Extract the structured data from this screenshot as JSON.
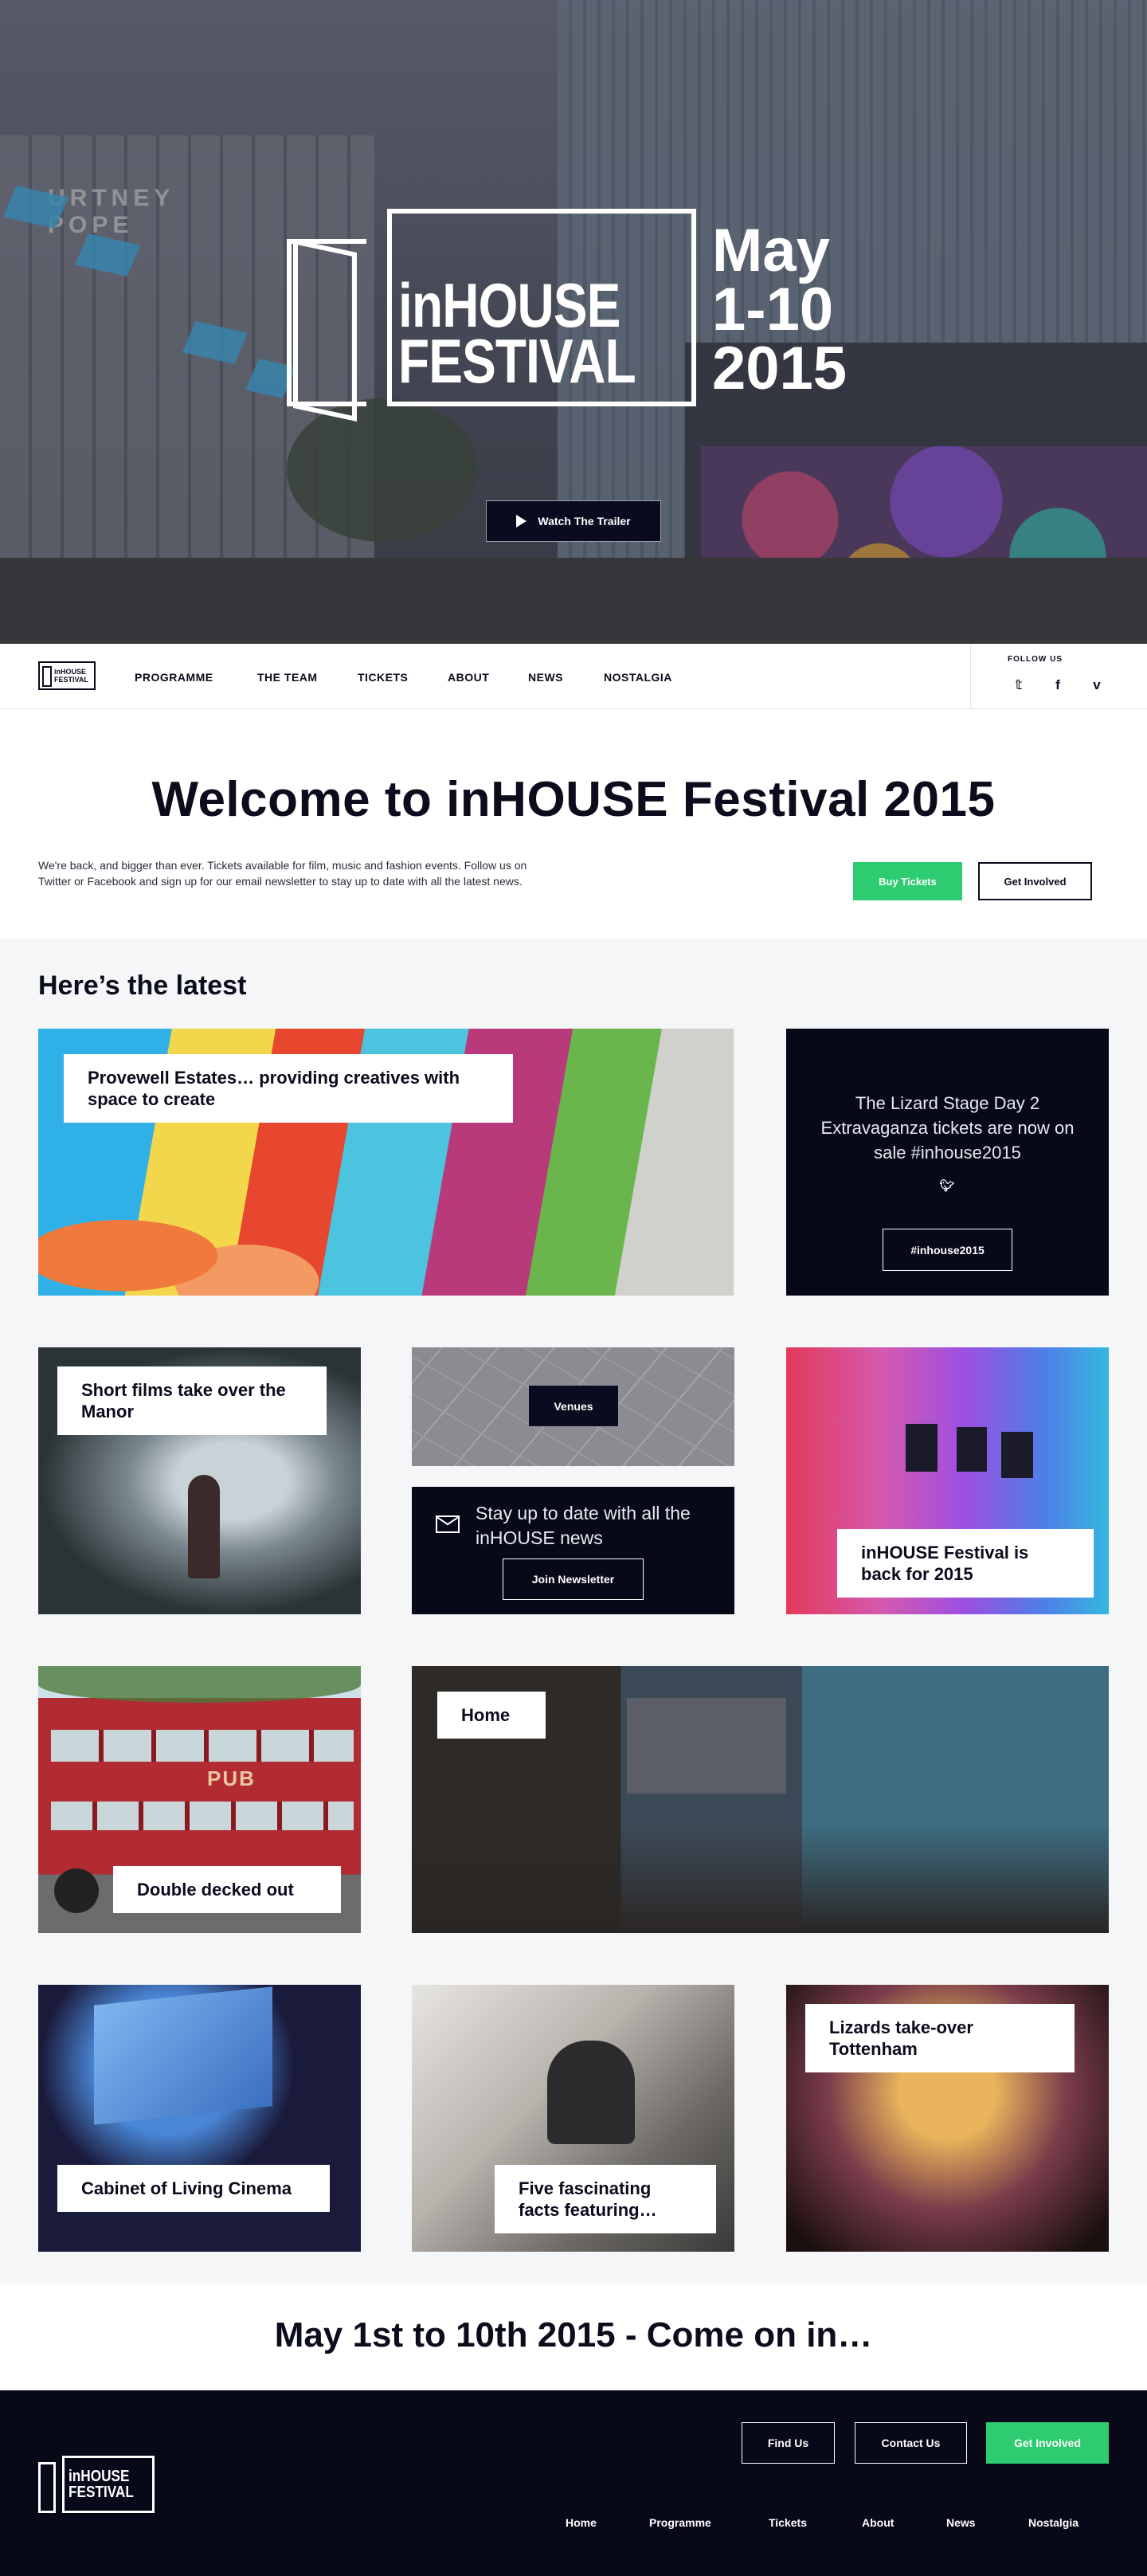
{
  "hero": {
    "logo_line1": "inHOUSE",
    "logo_line2": "FESTIVAL",
    "date_line1": "May",
    "date_line2": "1-10",
    "date_line3": "2015",
    "trailer_label": "Watch The Trailer",
    "bg_sign": "URTNEY POPE",
    "play_icon": "play-icon"
  },
  "nav": {
    "logo_line1": "inHOUSE",
    "logo_line2": "FESTIVAL",
    "items": [
      "PROGRAMME",
      "THE TEAM",
      "TICKETS",
      "ABOUT",
      "NEWS",
      "NOSTALGIA"
    ],
    "follow_label": "FOLLOW US",
    "social": [
      {
        "icon": "twitter-icon",
        "glyph": "𝕥"
      },
      {
        "icon": "facebook-icon",
        "glyph": "f"
      },
      {
        "icon": "vimeo-icon",
        "glyph": "v"
      }
    ]
  },
  "welcome": {
    "title": "Welcome to inHOUSE Festival 2015",
    "text": "We're back, and bigger than ever. Tickets available for film, music and fashion events. Follow us on Twitter or Facebook and sign up for our email newsletter to stay up to date with all the latest news.",
    "buy_label": "Buy Tickets",
    "involved_label": "Get Involved"
  },
  "latest": {
    "title": "Here’s the latest",
    "cards": {
      "provewell": "Provewell Estates… providing creatives with space to create",
      "lizard_text": "The Lizard Stage Day 2 Extravaganza tickets are now on sale #inhouse2015",
      "lizard_btn": "#inhouse2015",
      "short_films": "Short films take over the Manor",
      "venues": "Venues",
      "newsletter_text": "Stay up to date with all the inHOUSE news",
      "newsletter_btn": "Join Newsletter",
      "back_2015": "inHOUSE Festival is back for 2015",
      "double_decked": "Double decked out",
      "home": "Home",
      "cabinet": "Cabinet of Living Cinema",
      "five_facts": "Five fascinating facts featuring…",
      "lizards": "Lizards take-over Tottenham",
      "bus_sign": "PUB"
    }
  },
  "bottom": {
    "title": "May 1st to 10th 2015 - Come on in…"
  },
  "footer": {
    "logo_line1": "inHOUSE",
    "logo_line2": "FESTIVAL",
    "find_us": "Find Us",
    "contact_us": "Contact Us",
    "get_involved": "Get Involved",
    "links": [
      "Home",
      "Programme",
      "Tickets",
      "About",
      "News",
      "Nostalgia"
    ]
  },
  "colors": {
    "dark": "#070818",
    "green": "#2ecc71",
    "light_bg": "#f5f6f7"
  }
}
